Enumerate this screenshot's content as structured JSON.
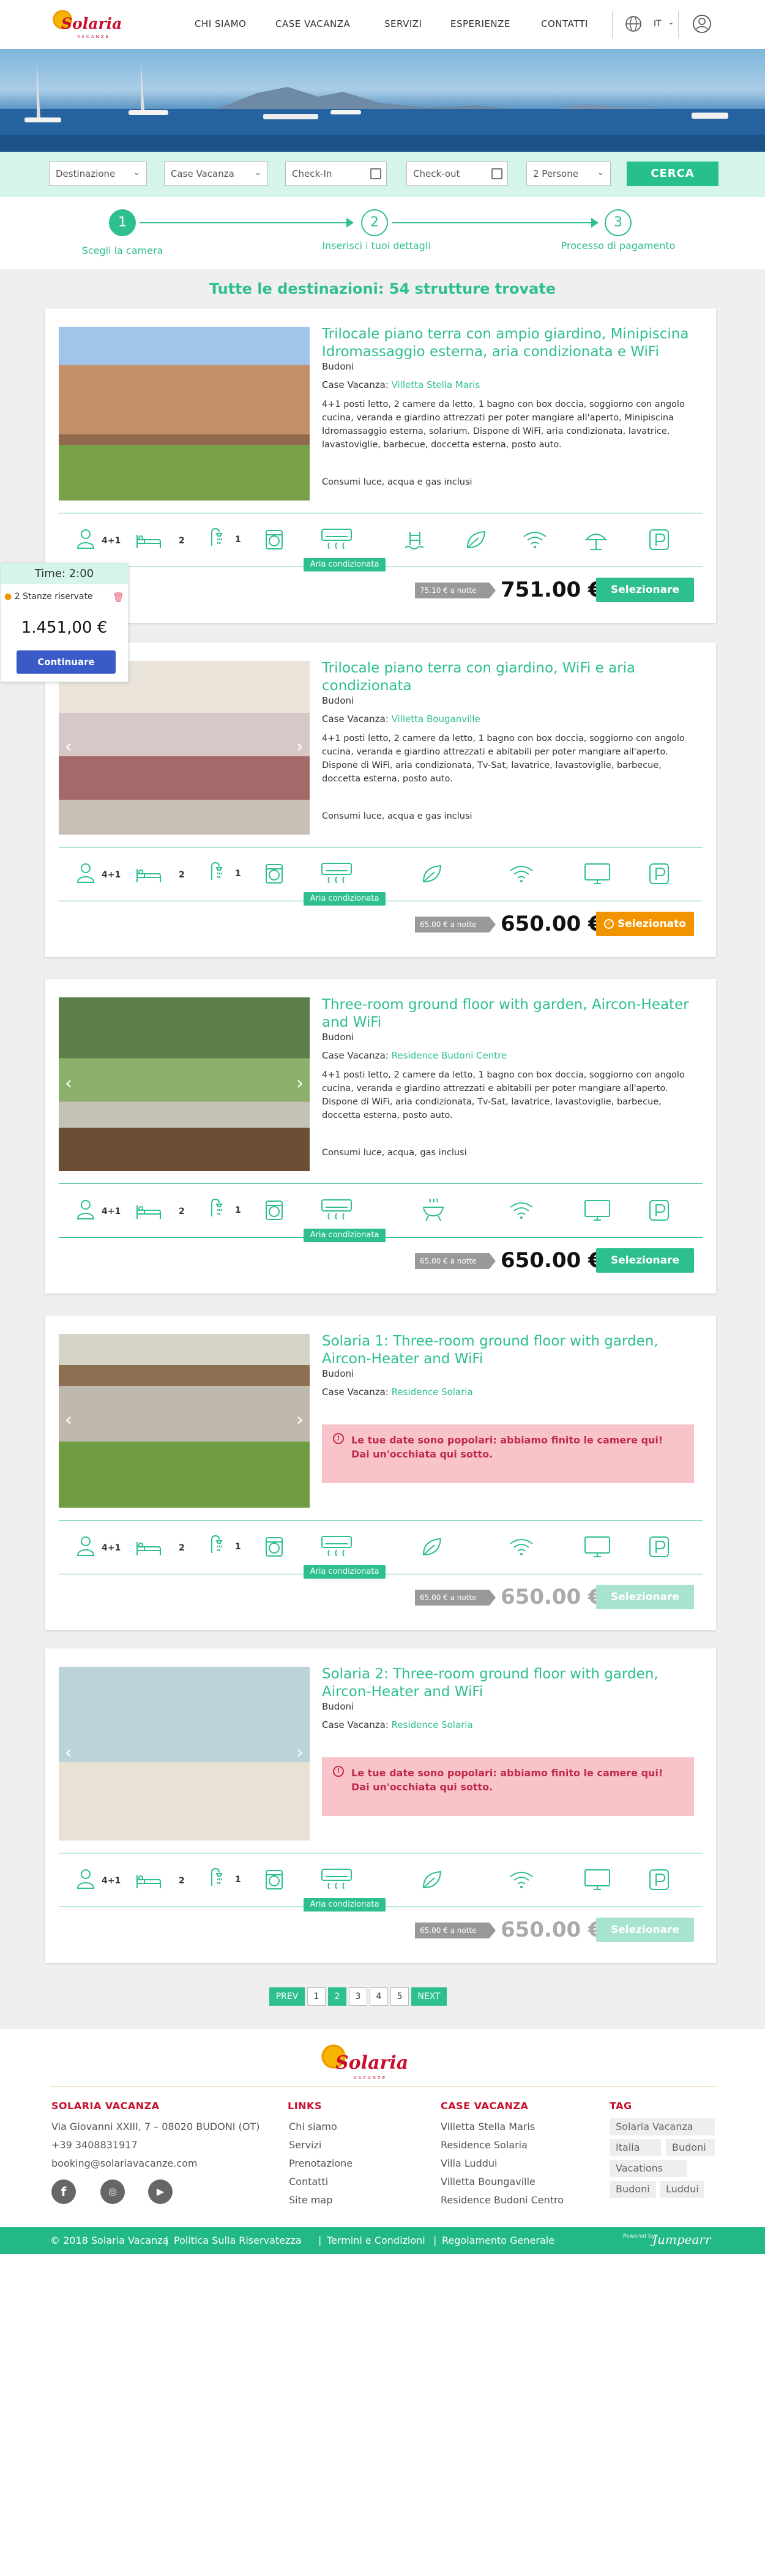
{
  "brand": {
    "name": "Solaria",
    "tagline": "VACANZE"
  },
  "nav": {
    "items": [
      "CHI SIAMO",
      "CASE VACANZA",
      "SERVIZI",
      "ESPERIENZE",
      "CONTATTI"
    ],
    "lang": "IT",
    "globe_icon": "globe-icon",
    "user_icon": "user-circle-icon"
  },
  "search": {
    "destinazione": "Destinazione",
    "case_vacanza": "Case Vacanza",
    "checkin": "Check-In",
    "checkout": "Check-out",
    "persone": "2 Persone",
    "button": "CERCA"
  },
  "steps": [
    {
      "num": "1",
      "label": "Scegli la camera"
    },
    {
      "num": "2",
      "label": "Inserisci i tuoi dettagli"
    },
    {
      "num": "3",
      "label": "Processo di pagamento"
    }
  ],
  "results_title": "Tutte le destinazioni: 54 strutture trovate",
  "timer": {
    "time": "Time: 2:00",
    "rooms": "2 Stanze riservate",
    "total": "1.451,00 €",
    "button": "Continuare"
  },
  "listings": [
    {
      "title": "Trilocale piano terra con ampio giardino, Minipiscina Idromassaggio esterna, aria condizionata e WiFi",
      "city": "Budoni",
      "case_label": "Case Vacanza:",
      "case_name": "Villetta Stella Maris",
      "description": "4+1 posti letto, 2 camere da letto, 1 bagno con box doccia, soggiorno con angolo cucina, veranda e giardino attrezzati per poter mangiare all'aperto, Minipiscina Idromassaggio esterna, solarium. Dispone di WiFi, aria condizionata, lavatrice, lavastoviglie, barbecue, doccetta esterna, posto auto.",
      "included": "Consumi luce, acqua e gas inclusi",
      "guests": "4+1",
      "beds": "2",
      "baths": "1",
      "aria": "Aria condizionata",
      "per_night": "75.10 € a notte",
      "price": "751.00 €",
      "button": "Selezionare",
      "state": "normal"
    },
    {
      "title": "Trilocale piano terra con giardino, WiFi e aria condizionata",
      "city": "Budoni",
      "case_label": "Case Vacanza:",
      "case_name": "Villetta Bouganville",
      "description": "4+1 posti letto, 2 camere da letto, 1 bagno con box doccia, soggiorno con angolo cucina, veranda e giardino attrezzati e abitabili per poter mangiare all'aperto. Dispone di WiFi, aria condizionata, Tv-Sat, lavatrice, lavastoviglie, barbecue, doccetta esterna, posto auto.",
      "included": "Consumi luce, acqua e gas inclusi",
      "guests": "4+1",
      "beds": "2",
      "baths": "1",
      "aria": "Aria condizionata",
      "per_night": "65.00 € a notte",
      "price": "650.00 €",
      "button": "Selezionato",
      "state": "selected"
    },
    {
      "title": "Three-room ground floor with garden, Aircon-Heater and WiFi",
      "city": "Budoni",
      "case_label": "Case Vacanza:",
      "case_name": "Residence Budoni Centre",
      "description": "4+1 posti letto, 2 camere da letto, 1 bagno con box doccia, soggiorno con angolo cucina, veranda e giardino attrezzati e abitabili per poter mangiare all'aperto. Dispone di WiFi, aria condizionata, Tv-Sat, lavatrice, lavastoviglie, barbecue, doccetta esterna, posto auto.",
      "included": "Consumi luce, acqua, gas inclusi",
      "guests": "4+1",
      "beds": "2",
      "baths": "1",
      "aria": "Aria condizionata",
      "per_night": "65.00 € a notte",
      "price": "650.00 €",
      "button": "Selezionare",
      "state": "normal"
    },
    {
      "title": "Solaria 1: Three-room ground floor with garden, Aircon-Heater and WiFi",
      "city": "Budoni",
      "case_label": "Case Vacanza:",
      "case_name": "Residence Solaria",
      "alert": "Le tue date sono popolari: abbiamo finito le camere qui! Dai un'occhiata qui sotto.",
      "guests": "4+1",
      "beds": "2",
      "baths": "1",
      "aria": "Aria condizionata",
      "per_night": "65.00 € a notte",
      "price": "650.00 €",
      "button": "Selezionare",
      "state": "soldout"
    },
    {
      "title": "Solaria 2: Three-room ground floor with garden, Aircon-Heater and WiFi",
      "city": "Budoni",
      "case_label": "Case Vacanza:",
      "case_name": "Residence Solaria",
      "alert": "Le tue date sono popolari: abbiamo finito le camere qui! Dai un'occhiata qui sotto.",
      "guests": "4+1",
      "beds": "2",
      "baths": "1",
      "aria": "Aria condizionata",
      "per_night": "65.00 € a notte",
      "price": "650.00 €",
      "button": "Selezionare",
      "state": "soldout"
    }
  ],
  "pagination": {
    "prev": "PREV",
    "pages": [
      "1",
      "2",
      "3",
      "4",
      "5"
    ],
    "current": "2",
    "next": "NEXT"
  },
  "footer": {
    "col1": {
      "title": "SOLARIA VACANZA",
      "lines": [
        "Via Giovanni XXIII, 7 – 08020 BUDONI (OT)",
        "+39 3408831917",
        "booking@solariavacanze.com"
      ],
      "social": [
        "facebook-icon",
        "tripadvisor-icon",
        "youtube-icon"
      ]
    },
    "col2": {
      "title": "LINKS",
      "items": [
        "Chi siamo",
        "Servizi",
        "Prenotazione",
        "Contatti",
        "Site map"
      ]
    },
    "col3": {
      "title": "CASE VACANZA",
      "items": [
        "Villetta Stella Maris",
        "Residence Solaria",
        "Villa Luddui",
        "Villetta Boungaville",
        "Residence Budoni Centro"
      ]
    },
    "col4": {
      "title": "TAG",
      "tags": [
        "Solaria Vacanza",
        "Italia",
        "Budoni",
        "Vacations",
        "Budoni",
        "Luddui"
      ]
    },
    "bar": {
      "copyright": "© 2018 Solaria Vacanza",
      "links": [
        "Politica Sulla Riservatezza",
        "Termini e Condizioni",
        "Regolamento Generale"
      ],
      "powered_label": "Powered by",
      "powered_name": "Jumpearr"
    }
  },
  "colors": {
    "accent": "#2ebf8e",
    "brand_red": "#c8102e",
    "selected_orange": "#f29400",
    "alert_pink": "#f8c3c9"
  }
}
